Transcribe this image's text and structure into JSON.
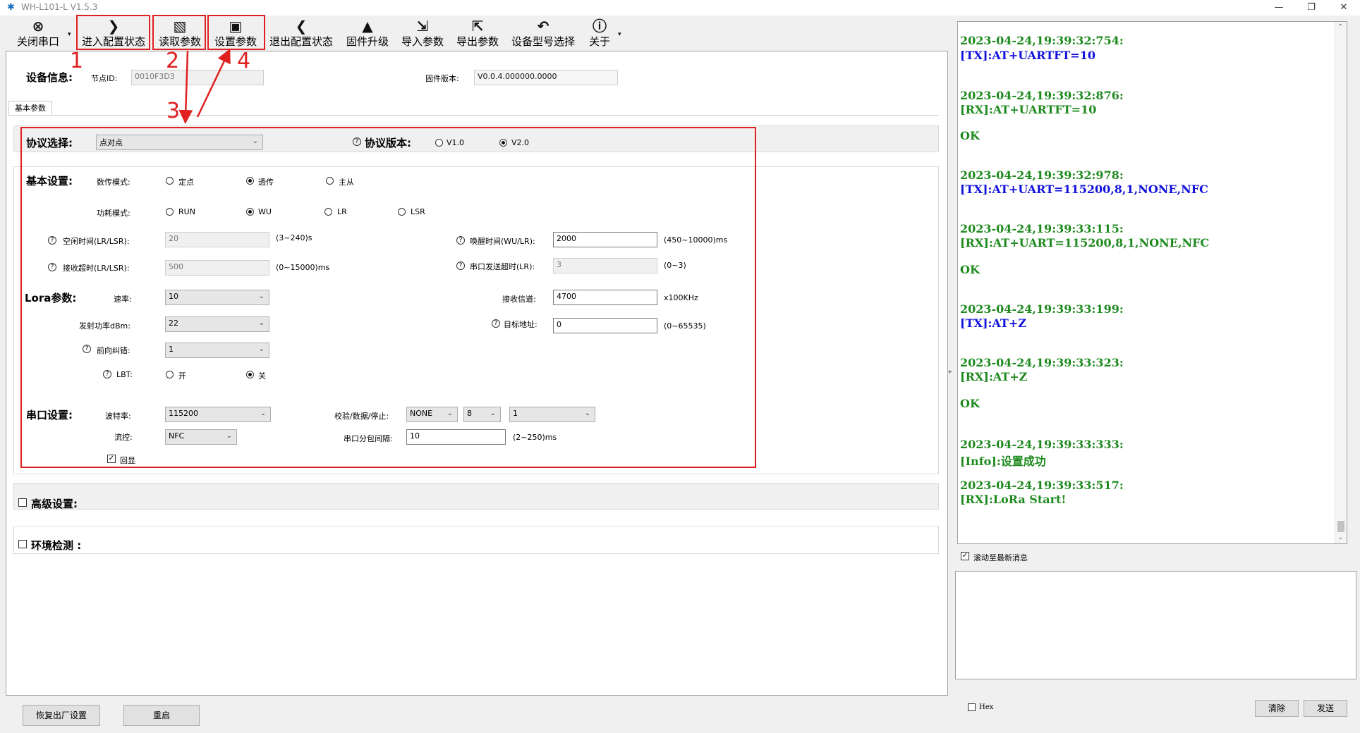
{
  "window": {
    "title": "WH-L101-L V1.5.3"
  },
  "toolbar": {
    "items": [
      {
        "label": "关闭串口",
        "icon": "close-port-icon",
        "glyph": "⊗"
      },
      {
        "label": "进入配置状态",
        "icon": "chevron-right-icon",
        "glyph": "❯"
      },
      {
        "label": "读取参数",
        "icon": "read-params-icon",
        "glyph": "▧"
      },
      {
        "label": "设置参数",
        "icon": "save-icon",
        "glyph": "▣"
      },
      {
        "label": "退出配置状态",
        "icon": "chevron-left-icon",
        "glyph": "❮"
      },
      {
        "label": "固件升级",
        "icon": "firmware-upgrade-icon",
        "glyph": "▲"
      },
      {
        "label": "导入参数",
        "icon": "import-icon",
        "glyph": "⇲"
      },
      {
        "label": "导出参数",
        "icon": "export-icon",
        "glyph": "⇱"
      },
      {
        "label": "设备型号选择",
        "icon": "undo-icon",
        "glyph": "↶"
      },
      {
        "label": "关于",
        "icon": "info-icon",
        "glyph": "ⓘ"
      }
    ]
  },
  "annotations": {
    "numbers": [
      "1",
      "2",
      "3",
      "4"
    ],
    "color": "#e02020"
  },
  "device_info": {
    "header": "设备信息:",
    "node_id_label": "节点ID:",
    "node_id": "0010F3D3",
    "firmware_label": "固件版本:",
    "firmware": "V0.0.4.000000.0000"
  },
  "tab": "基本参数",
  "protocol": {
    "label": "协议选择:",
    "value": "点对点",
    "version_label": "协议版本:",
    "v1": "V1.0",
    "v2": "V2.0",
    "selected": "V2.0"
  },
  "basic": {
    "header": "基本设置:",
    "transfer_label": "数传模式:",
    "transfer_options": [
      "定点",
      "透传",
      "主从"
    ],
    "transfer_selected": "透传",
    "power_label": "功耗模式:",
    "power_options": [
      "RUN",
      "WU",
      "LR",
      "LSR"
    ],
    "power_selected": "WU",
    "idle_label": "空闲时间(LR/LSR):",
    "idle_value": "20",
    "idle_range": "(3~240)s",
    "wake_label": "唤醒时间(WU/LR):",
    "wake_value": "2000",
    "wake_range": "(450~10000)ms",
    "recv_timeout_label": "接收超时(LR/LSR):",
    "recv_timeout_value": "500",
    "recv_timeout_range": "(0~15000)ms",
    "uart_send_timeout_label": "串口发送超时(LR):",
    "uart_send_timeout_value": "3",
    "uart_send_timeout_range": "(0~3)"
  },
  "lora": {
    "header": "Lora参数:",
    "rate_label": "速率:",
    "rate_value": "10",
    "channel_label": "接收信道:",
    "channel_value": "4700",
    "channel_unit": "x100KHz",
    "txpower_label": "发射功率dBm:",
    "txpower_value": "22",
    "target_label": "目标地址:",
    "target_value": "0",
    "target_range": "(0~65535)",
    "fec_label": "前向纠错:",
    "fec_value": "1",
    "lbt_label": "LBT:",
    "lbt_on": "开",
    "lbt_off": "关",
    "lbt_selected": "关"
  },
  "serial": {
    "header": "串口设置:",
    "baud_label": "波特率:",
    "baud_value": "115200",
    "parity_label": "校验/数据/停止:",
    "parity_value": "NONE",
    "data_value": "8",
    "stop_value": "1",
    "flow_label": "流控:",
    "flow_value": "NFC",
    "pkt_interval_label": "串口分包间隔:",
    "pkt_interval_value": "10",
    "pkt_interval_range": "(2~250)ms",
    "echo_label": "回显",
    "echo_checked": true
  },
  "advanced": {
    "label": "高级设置:"
  },
  "env": {
    "label": "环境检测 :"
  },
  "bottom_buttons": {
    "factory_reset": "恢复出厂设置",
    "restart": "重启"
  },
  "log": {
    "entries": [
      {
        "time": "2023-04-24,19:39:32:754:",
        "msg": "[TX]:AT+UARTFT=10",
        "type": "tx",
        "ok": false
      },
      {
        "time": "2023-04-24,19:39:32:876:",
        "msg": "[RX]:AT+UARTFT=10",
        "type": "rx",
        "ok": true
      },
      {
        "time": "2023-04-24,19:39:32:978:",
        "msg": "[TX]:AT+UART=115200,8,1,NONE,NFC",
        "type": "tx",
        "ok": false
      },
      {
        "time": "2023-04-24,19:39:33:115:",
        "msg": "[RX]:AT+UART=115200,8,1,NONE,NFC",
        "type": "rx",
        "ok": true
      },
      {
        "time": "2023-04-24,19:39:33:199:",
        "msg": "[TX]:AT+Z",
        "type": "tx",
        "ok": false
      },
      {
        "time": "2023-04-24,19:39:33:323:",
        "msg": "[RX]:AT+Z",
        "type": "rx",
        "ok": true
      },
      {
        "time": "2023-04-24,19:39:33:333:",
        "msg": "[Info]:设置成功",
        "type": "rx",
        "ok": false
      },
      {
        "time": "2023-04-24,19:39:33:517:",
        "msg": "[RX]:LoRa Start!",
        "type": "rx",
        "ok": false
      }
    ],
    "ok_text": "OK",
    "scroll_latest_label": "滚动至最新消息",
    "scroll_latest_checked": true
  },
  "send": {
    "hex_label": "Hex",
    "clear_button": "清除",
    "send_button": "发送"
  }
}
